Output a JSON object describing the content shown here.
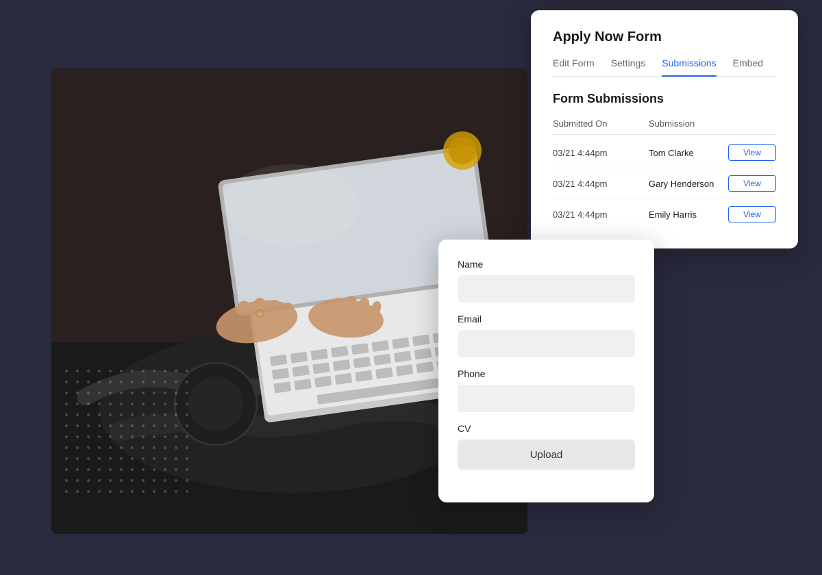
{
  "background": {
    "color": "#1a1a2e"
  },
  "submissions_card": {
    "title": "Apply Now Form",
    "tabs": [
      {
        "label": "Edit Form",
        "active": false
      },
      {
        "label": "Settings",
        "active": false
      },
      {
        "label": "Submissions",
        "active": true
      },
      {
        "label": "Embed",
        "active": false
      }
    ],
    "section_heading": "Form Submissions",
    "table_headers": [
      {
        "label": "Submitted On"
      },
      {
        "label": "Submission"
      },
      {
        "label": ""
      }
    ],
    "rows": [
      {
        "date": "03/21 4:44pm",
        "name": "Tom Clarke",
        "btn_label": "View"
      },
      {
        "date": "03/21 4:44pm",
        "name": "Gary Henderson",
        "btn_label": "View"
      },
      {
        "date": "03/21 4:44pm",
        "name": "Emily Harris",
        "btn_label": "View"
      }
    ]
  },
  "form_card": {
    "fields": [
      {
        "label": "Name",
        "type": "text"
      },
      {
        "label": "Email",
        "type": "text"
      },
      {
        "label": "Phone",
        "type": "text"
      },
      {
        "label": "CV",
        "type": "upload"
      }
    ],
    "upload_label": "Upload"
  }
}
